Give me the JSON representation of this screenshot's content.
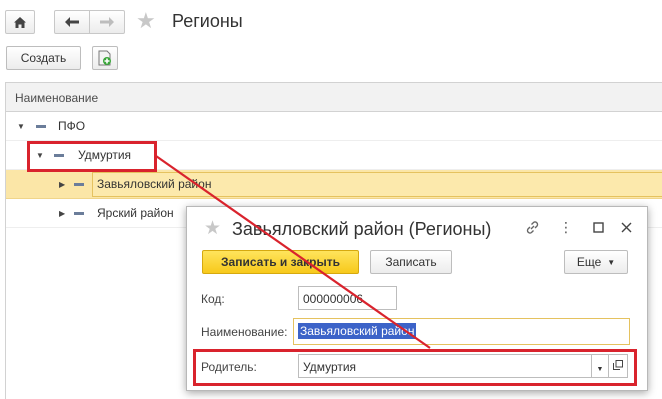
{
  "header": {
    "title": "Регионы"
  },
  "toolbar": {
    "create_label": "Создать"
  },
  "tree": {
    "column_header": "Наименование",
    "rows": [
      {
        "label": "ПФО",
        "level": 0,
        "expanded": true,
        "selected": false
      },
      {
        "label": "Удмуртия",
        "level": 1,
        "expanded": true,
        "selected": false
      },
      {
        "label": "Завьяловский район",
        "level": 2,
        "expanded": false,
        "selected": true
      },
      {
        "label": "Ярский район",
        "level": 2,
        "expanded": false,
        "selected": false
      }
    ]
  },
  "dialog": {
    "title": "Завьяловский район (Регионы)",
    "save_close_label": "Записать и закрыть",
    "save_label": "Записать",
    "more_label": "Еще",
    "code_label": "Код:",
    "code_value": "000000006",
    "name_label": "Наименование:",
    "name_value": "Завьяловский район",
    "parent_label": "Родитель:",
    "parent_value": "Удмуртия"
  },
  "colors": {
    "highlight": "#d9232d",
    "selected_row": "#fbe6a7",
    "primary_button": "#f7c91b"
  }
}
